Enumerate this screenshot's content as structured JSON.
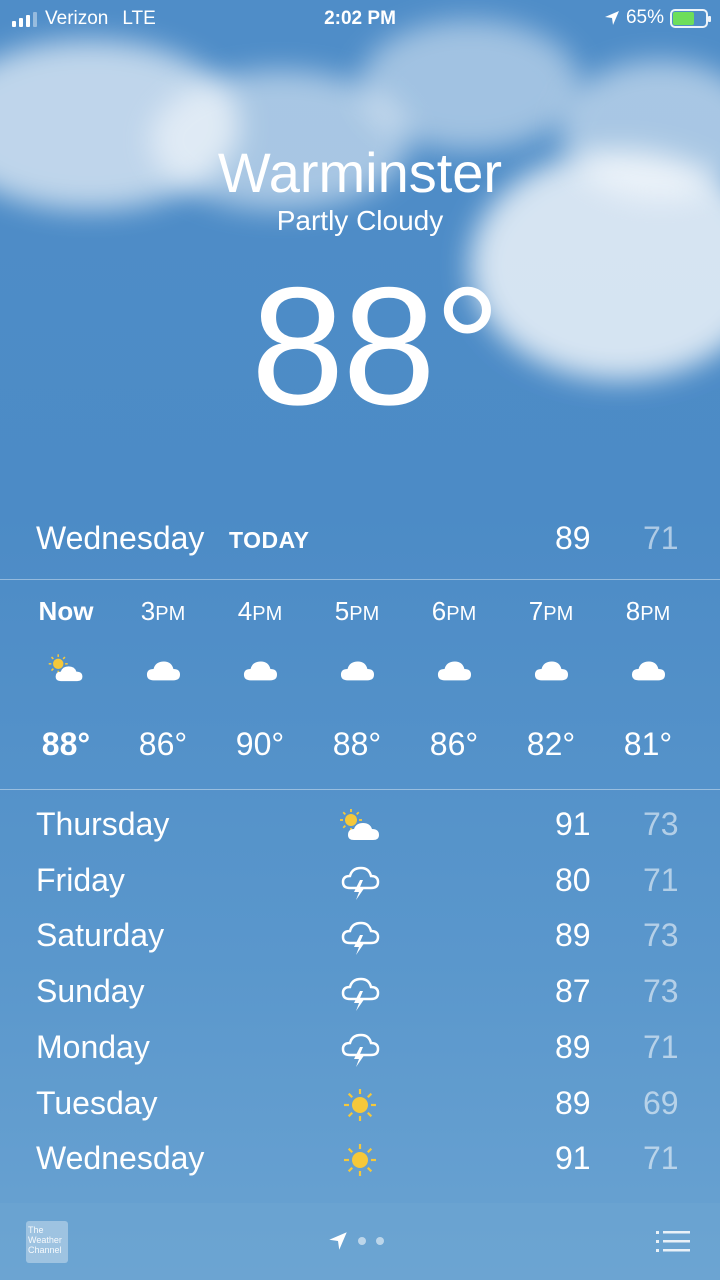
{
  "status_bar": {
    "carrier": "Verizon",
    "network": "LTE",
    "time": "2:02 PM",
    "battery": "65%",
    "battery_level": 0.65,
    "icons": [
      "signal-icon",
      "location-arrow-icon",
      "battery-charging-icon"
    ]
  },
  "header": {
    "city": "Warminster",
    "condition": "Partly Cloudy",
    "temperature": "88°"
  },
  "today": {
    "day": "Wednesday",
    "label": "TODAY",
    "high": "89",
    "low": "71"
  },
  "hourly": [
    {
      "time": "Now",
      "ampm": "",
      "temp": "88°",
      "icon": "partly-cloudy-icon"
    },
    {
      "time": "3",
      "ampm": "PM",
      "temp": "86°",
      "icon": "cloud-icon"
    },
    {
      "time": "4",
      "ampm": "PM",
      "temp": "90°",
      "icon": "cloud-icon"
    },
    {
      "time": "5",
      "ampm": "PM",
      "temp": "88°",
      "icon": "cloud-icon"
    },
    {
      "time": "6",
      "ampm": "PM",
      "temp": "86°",
      "icon": "cloud-icon"
    },
    {
      "time": "7",
      "ampm": "PM",
      "temp": "82°",
      "icon": "cloud-icon"
    },
    {
      "time": "8",
      "ampm": "PM",
      "temp": "81°",
      "icon": "cloud-icon"
    }
  ],
  "daily": [
    {
      "day": "Thursday",
      "high": "91",
      "low": "73",
      "icon": "partly-cloudy-icon"
    },
    {
      "day": "Friday",
      "high": "80",
      "low": "71",
      "icon": "thunderstorm-icon"
    },
    {
      "day": "Saturday",
      "high": "89",
      "low": "73",
      "icon": "thunderstorm-icon"
    },
    {
      "day": "Sunday",
      "high": "87",
      "low": "73",
      "icon": "thunderstorm-icon"
    },
    {
      "day": "Monday",
      "high": "89",
      "low": "71",
      "icon": "thunderstorm-icon"
    },
    {
      "day": "Tuesday",
      "high": "89",
      "low": "69",
      "icon": "sun-icon"
    },
    {
      "day": "Wednesday",
      "high": "91",
      "low": "71",
      "icon": "sun-icon"
    }
  ],
  "toolbar": {
    "logo_text": "The Weather Channel",
    "page_count": 3,
    "current_page_icon": "location-arrow-icon",
    "list_icon": "list-icon"
  },
  "colors": {
    "background": "#4f8dc8",
    "sun": "#f5c83a",
    "battery_fill": "#6ede5a"
  }
}
